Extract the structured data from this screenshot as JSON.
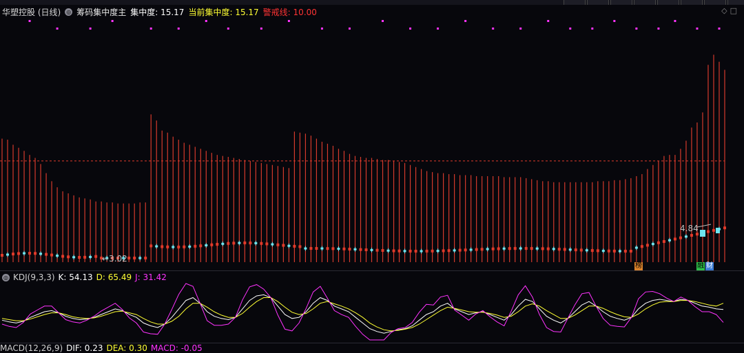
{
  "header": {
    "stock_name": "华塑控股 (日线)",
    "indicator": "筹码集中度主",
    "label1": "集中度:",
    "value1": "15.17",
    "label2": "当前集中度:",
    "value2": "15.17",
    "label3": "警戒线:",
    "value3": "10.00"
  },
  "kdj": {
    "title": "KDJ(9,3,3)",
    "k_label": "K: 54.13",
    "d_label": "D: 65.49",
    "j_label": "J: 31.42"
  },
  "macd": {
    "title": "MACD(12,26,9)",
    "dif_label": "DIF: 0.23",
    "dea_label": "DEA: 0.30",
    "macd_label": "MACD: -0.05"
  },
  "annotations": {
    "low_label": "3.02",
    "high_label": "4.84",
    "tag1": "榜",
    "tag2": "融",
    "tag3": "财"
  },
  "colors": {
    "concentration_bar": "#d53a2c",
    "alert_line": "#e23b2b",
    "candle_up": "#e03a2a",
    "candle_down": "#6ee6f0",
    "k_line": "#ffffff",
    "d_line": "#ffff33",
    "j_line": "#ff33ff",
    "dot": "#ff33ff"
  },
  "chart_data": [
    {
      "type": "bar",
      "title": "筹码集中度主",
      "alert_line": 10.0,
      "last_value": 15.17,
      "ylim": [
        0,
        24
      ],
      "values": [
        12.2,
        12.1,
        11.6,
        11.3,
        11.0,
        10.6,
        10.3,
        9.7,
        8.8,
        8.0,
        7.4,
        7.0,
        6.8,
        6.6,
        6.4,
        6.3,
        6.2,
        6.0,
        6.0,
        5.9,
        5.9,
        5.8,
        5.8,
        5.8,
        5.8,
        5.9,
        5.9,
        14.6,
        14.0,
        13.0,
        12.8,
        12.4,
        12.1,
        11.8,
        11.6,
        11.4,
        11.2,
        11.0,
        10.8,
        10.6,
        10.5,
        10.4,
        10.3,
        10.2,
        10.1,
        10.0,
        9.9,
        9.8,
        9.7,
        9.6,
        9.5,
        9.4,
        9.3,
        12.9,
        12.8,
        12.7,
        12.5,
        12.2,
        11.9,
        11.7,
        11.5,
        11.2,
        11.0,
        10.7,
        10.5,
        10.4,
        10.3,
        10.3,
        10.2,
        10.1,
        10.1,
        10.0,
        9.9,
        9.8,
        9.6,
        9.4,
        9.2,
        9.0,
        8.9,
        8.8,
        8.8,
        8.7,
        8.7,
        8.6,
        8.6,
        8.6,
        8.5,
        8.5,
        8.5,
        8.5,
        8.5,
        8.4,
        8.4,
        8.4,
        8.4,
        8.3,
        8.2,
        8.1,
        8.0,
        8.0,
        7.9,
        7.9,
        7.9,
        7.9,
        7.9,
        7.9,
        7.9,
        7.9,
        8.0,
        8.0,
        8.0,
        8.1,
        8.1,
        8.2,
        8.3,
        8.5,
        8.7,
        9.2,
        9.6,
        10.0,
        10.5,
        10.6,
        10.6,
        11.2,
        12.0,
        13.3,
        13.8,
        14.8,
        19.5,
        20.5,
        19.8,
        19.0
      ]
    },
    {
      "type": "line",
      "title": "KDJ(9,3,3)",
      "ylim": [
        0,
        100
      ],
      "series": [
        {
          "name": "K",
          "values": [
            35,
            32,
            30,
            33,
            40,
            45,
            50,
            52,
            48,
            42,
            38,
            36,
            37,
            40,
            45,
            50,
            55,
            52,
            45,
            40,
            30,
            25,
            22,
            28,
            40,
            55,
            70,
            75,
            65,
            50,
            42,
            38,
            36,
            40,
            55,
            70,
            78,
            80,
            75,
            60,
            45,
            38,
            40,
            50,
            65,
            75,
            70,
            60,
            55,
            50,
            40,
            30,
            20,
            15,
            12,
            15,
            18,
            20,
            25,
            35,
            45,
            50,
            60,
            65,
            55,
            50,
            45,
            48,
            50,
            45,
            40,
            35,
            45,
            60,
            72,
            68,
            55,
            42,
            35,
            30,
            38,
            50,
            62,
            68,
            60,
            50,
            42,
            38,
            35,
            40,
            55,
            65,
            70,
            72,
            70,
            68,
            72,
            70,
            65,
            60,
            58,
            55,
            54
          ]
        },
        {
          "name": "D",
          "values": [
            38,
            36,
            34,
            34,
            37,
            41,
            45,
            48,
            48,
            45,
            41,
            39,
            38,
            39,
            42,
            46,
            50,
            51,
            48,
            45,
            38,
            32,
            28,
            28,
            33,
            42,
            55,
            65,
            65,
            58,
            50,
            44,
            40,
            40,
            47,
            58,
            68,
            75,
            75,
            68,
            58,
            49,
            45,
            47,
            55,
            65,
            68,
            64,
            60,
            55,
            48,
            40,
            30,
            23,
            18,
            16,
            17,
            19,
            22,
            28,
            36,
            44,
            52,
            58,
            56,
            53,
            50,
            49,
            49,
            47,
            44,
            40,
            42,
            50,
            60,
            64,
            60,
            52,
            45,
            38,
            38,
            44,
            52,
            60,
            60,
            56,
            50,
            45,
            41,
            40,
            46,
            55,
            62,
            67,
            68,
            68,
            70,
            70,
            68,
            65,
            62,
            60,
            65
          ]
        },
        {
          "name": "J",
          "values": [
            28,
            24,
            22,
            31,
            46,
            53,
            60,
            60,
            48,
            36,
            32,
            30,
            35,
            42,
            51,
            58,
            65,
            54,
            39,
            30,
            14,
            11,
            10,
            28,
            54,
            81,
            100,
            95,
            65,
            34,
            26,
            26,
            28,
            40,
            71,
            94,
            98,
            90,
            75,
            44,
            19,
            16,
            30,
            56,
            85,
            95,
            74,
            52,
            45,
            40,
            24,
            10,
            0,
            0,
            0,
            13,
            20,
            22,
            31,
            49,
            63,
            62,
            76,
            79,
            53,
            44,
            35,
            46,
            52,
            41,
            32,
            25,
            51,
            80,
            96,
            76,
            45,
            22,
            15,
            14,
            38,
            62,
            82,
            84,
            60,
            38,
            26,
            24,
            23,
            40,
            73,
            85,
            86,
            82,
            74,
            68,
            76,
            70,
            59,
            50,
            50,
            45,
            31
          ]
        }
      ]
    }
  ]
}
